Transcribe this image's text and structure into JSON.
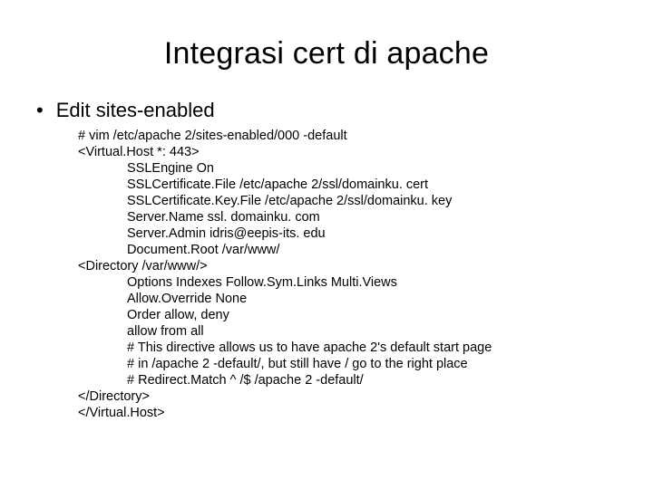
{
  "title": "Integrasi cert di apache",
  "bullet": "Edit sites-enabled",
  "code": [
    {
      "t": "# vim /etc/apache 2/sites-enabled/000 -default",
      "i": false
    },
    {
      "t": "<Virtual.Host *: 443>",
      "i": false
    },
    {
      "t": "SSLEngine On",
      "i": true
    },
    {
      "t": "SSLCertificate.File /etc/apache 2/ssl/domainku. cert",
      "i": true
    },
    {
      "t": "SSLCertificate.Key.File /etc/apache 2/ssl/domainku. key",
      "i": true
    },
    {
      "t": "Server.Name ssl. domainku. com",
      "i": true
    },
    {
      "t": "Server.Admin idris@eepis-its. edu",
      "i": true
    },
    {
      "t": "Document.Root /var/www/",
      "i": true
    },
    {
      "t": "<Directory /var/www/>",
      "i": false
    },
    {
      "t": "Options Indexes Follow.Sym.Links Multi.Views",
      "i": true
    },
    {
      "t": "Allow.Override None",
      "i": true
    },
    {
      "t": "Order allow, deny",
      "i": true
    },
    {
      "t": "allow from all",
      "i": true
    },
    {
      "t": "# This directive allows us to have apache 2's default start page",
      "i": true
    },
    {
      "t": "# in /apache 2 -default/, but still have / go to the right place",
      "i": true
    },
    {
      "t": "# Redirect.Match ^ /$ /apache 2 -default/",
      "i": true
    },
    {
      "t": "</Directory>",
      "i": false
    },
    {
      "t": "</Virtual.Host>",
      "i": false
    }
  ]
}
